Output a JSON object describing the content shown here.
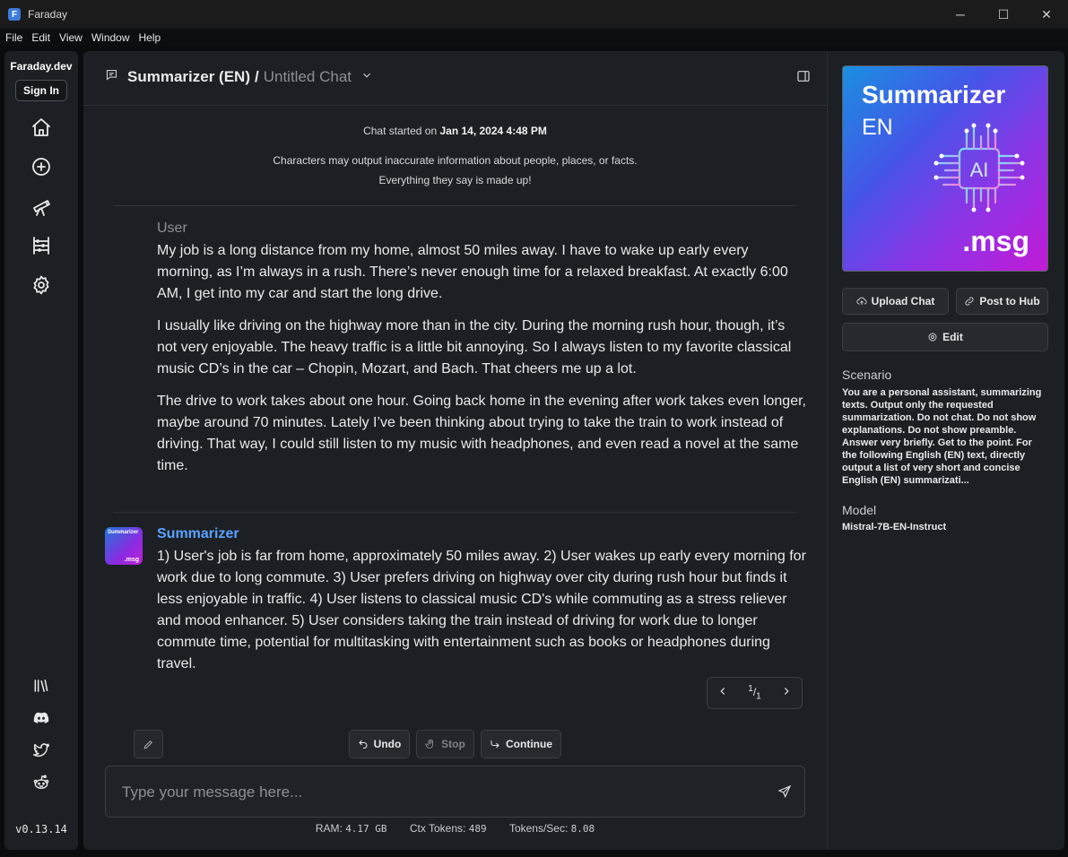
{
  "window": {
    "title": "Faraday",
    "minimize": "─",
    "maximize": "☐",
    "close": "✕"
  },
  "menu": [
    "File",
    "Edit",
    "View",
    "Window",
    "Help"
  ],
  "sidebar": {
    "brand": "Faraday.dev",
    "sign_in": "Sign In",
    "nav_icons": [
      "home-icon",
      "plus-circle-icon",
      "telescope-icon",
      "abacus-icon",
      "gear-icon"
    ],
    "bottom_icons": [
      "library-icon",
      "discord-icon",
      "twitter-icon",
      "reddit-icon"
    ],
    "version": "v0.13.14"
  },
  "header": {
    "character": "Summarizer (EN)",
    "separator": "/",
    "chat_name": "Untitled Chat"
  },
  "chat_info": {
    "started_prefix": "Chat started on",
    "started_date": "Jan 14, 2024 4:48 PM",
    "disclaimer_line1": "Characters may output inaccurate information about people, places, or facts.",
    "disclaimer_line2": "Everything they say is made up!"
  },
  "messages": {
    "user": {
      "author": "User",
      "paragraphs": [
        "My job is a long distance from my home, almost 50 miles away. I have to wake up early every morning, as I’m always in a rush. There’s never enough time for a relaxed breakfast. At exactly 6:00 AM, I get into my car and start the long drive.",
        "I usually like driving on the highway more than in the city. During the morning rush hour, though, it’s not very enjoyable. The heavy traffic is a little bit annoying. So I always listen to my favorite classical music CD’s in the car – Chopin, Mozart, and Bach. That cheers me up a lot.",
        "The drive to work takes about one hour. Going back home in the evening after work takes even longer, maybe around 70 minutes. Lately I’ve been thinking about trying to take the train to work instead of driving. That way, I could still listen to my music with headphones, and even read a novel at the same time."
      ]
    },
    "bot": {
      "author": "Summarizer",
      "avatar_title": "Summarizer",
      "avatar_tag": ".msg",
      "text": "1) User's job is far from home, approximately 50 miles away. 2) User wakes up early every morning for work due to long commute. 3) User prefers driving on highway over city during rush hour but finds it less enjoyable in traffic. 4) User listens to classical music CD's while commuting as a stress reliever and mood enhancer. 5) User considers taking the train instead of driving for work due to longer commute time, potential for multitasking with entertainment such as books or headphones during travel."
    }
  },
  "pager": {
    "current": "1",
    "total": "1",
    "slash": "/"
  },
  "actions": {
    "undo": "Undo",
    "stop": "Stop",
    "continue": "Continue"
  },
  "composer": {
    "placeholder": "Type your message here...",
    "value": ""
  },
  "stats": {
    "ram_label": "RAM:",
    "ram_value": "4.17 GB",
    "ctx_label": "Ctx Tokens:",
    "ctx_value": "489",
    "tps_label": "Tokens/Sec:",
    "tps_value": "8.08"
  },
  "right_panel": {
    "image_title": "Summarizer",
    "image_sub": "EN",
    "image_chip": "AI",
    "image_tag": ".msg",
    "upload_chat": "Upload Chat",
    "post_to_hub": "Post to Hub",
    "edit": "Edit",
    "scenario_label": "Scenario",
    "scenario_text": "You are a personal assistant, summarizing texts. Output only the requested summarization. Do not chat. Do not show explanations. Do not show preamble. Answer very briefly. Get to the point. For the following English (EN) text, directly output a list of very short and concise English (EN) summarizati...",
    "model_label": "Model",
    "model_text": "Mistral-7B-EN-Instruct"
  },
  "colors": {
    "accent_bot": "#5aa2ff",
    "panel_bg": "#1c2024",
    "app_bg": "#0b0c0e"
  }
}
